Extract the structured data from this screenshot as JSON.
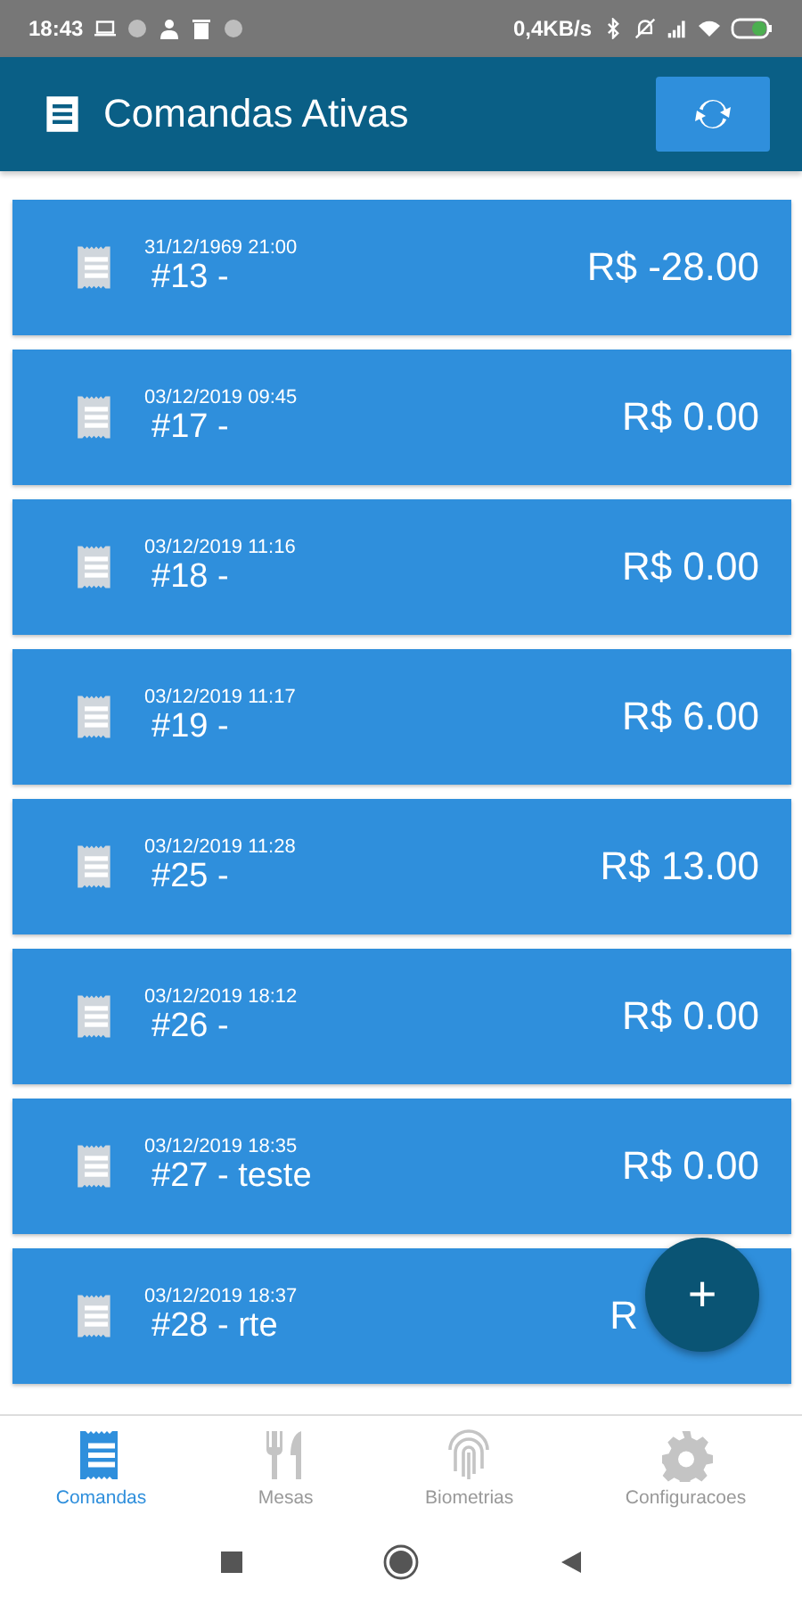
{
  "status_bar": {
    "time": "18:43",
    "speed": "0,4KB/s"
  },
  "header": {
    "title": "Comandas Ativas"
  },
  "orders": [
    {
      "date": "31/12/1969 21:00",
      "title": "#13 -",
      "amount": "R$ -28.00"
    },
    {
      "date": "03/12/2019 09:45",
      "title": "#17 -",
      "amount": "R$ 0.00"
    },
    {
      "date": "03/12/2019 11:16",
      "title": "#18 -",
      "amount": "R$ 0.00"
    },
    {
      "date": "03/12/2019 11:17",
      "title": "#19 -",
      "amount": "R$ 6.00"
    },
    {
      "date": "03/12/2019 11:28",
      "title": "#25 -",
      "amount": "R$ 13.00"
    },
    {
      "date": "03/12/2019 18:12",
      "title": "#26 -",
      "amount": "R$ 0.00"
    },
    {
      "date": "03/12/2019 18:35",
      "title": "#27 - teste",
      "amount": "R$ 0.00"
    },
    {
      "date": "03/12/2019 18:37",
      "title": "#28 - rte",
      "amount": "R",
      "covered": true
    }
  ],
  "fab": {
    "label": "+"
  },
  "nav": [
    {
      "kind": "receipt",
      "label": "Comandas",
      "selected": true
    },
    {
      "kind": "cutlery",
      "label": "Mesas",
      "selected": false
    },
    {
      "kind": "fingerprint",
      "label": "Biometrias",
      "selected": false
    },
    {
      "kind": "gear",
      "label": "Configuracoes",
      "selected": false
    }
  ]
}
